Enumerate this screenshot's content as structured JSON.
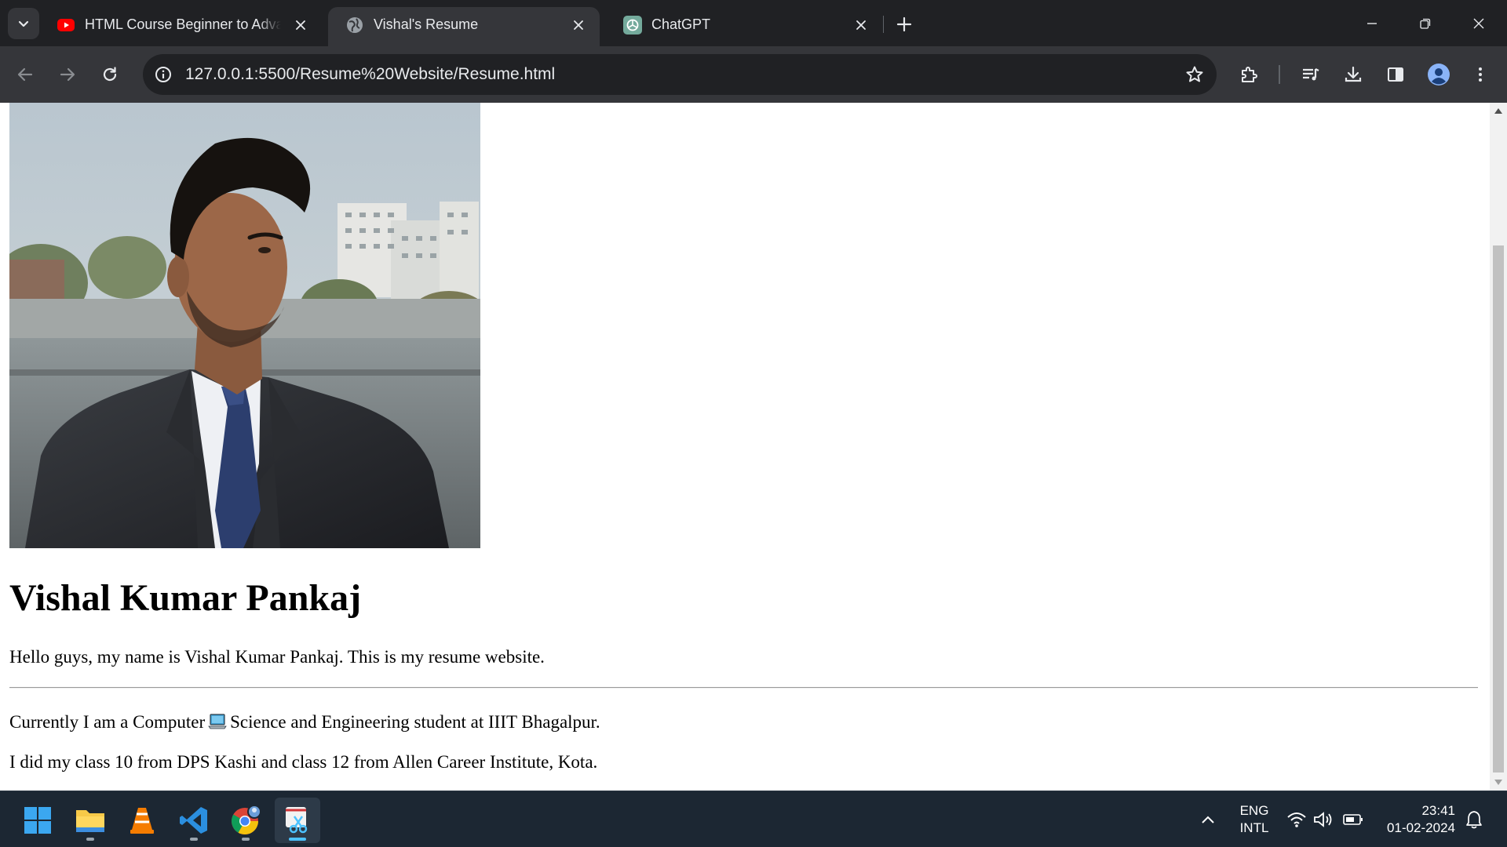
{
  "browser": {
    "tabs": [
      {
        "title": "HTML Course Beginner to Advanced",
        "favicon": "youtube-icon",
        "active": false
      },
      {
        "title": "Vishal's Resume",
        "favicon": "globe-icon",
        "active": true
      },
      {
        "title": "ChatGPT",
        "favicon": "chatgpt-icon",
        "active": false
      }
    ],
    "url": "127.0.0.1:5500/Resume%20Website/Resume.html",
    "colors": {
      "tabstrip": "#202124",
      "toolbar": "#35363a",
      "omnibox": "#202124",
      "text": "#e8eaed"
    }
  },
  "page": {
    "photo_alt": "Portrait photo of Vishal Kumar Pankaj in a dark suit and navy tie",
    "name": "Vishal Kumar Pankaj",
    "intro": "Hello guys, my name is Vishal Kumar Pankaj. This is my resume website.",
    "education_before": "Currently I am a Computer",
    "education_emoji": "laptop-icon",
    "education_after": "Science and Engineering student at IIIT Bhagalpur.",
    "schooling": "I did my class 10 from DPS Kashi and class 12 from Allen Career Institute, Kota."
  },
  "taskbar": {
    "apps": [
      "windows-start-icon",
      "file-explorer-icon",
      "vlc-icon",
      "vscode-icon",
      "chrome-icon",
      "snipping-tool-icon"
    ],
    "language_line1": "ENG",
    "language_line2": "INTL",
    "time": "23:41",
    "date": "01-02-2024",
    "colors": {
      "background": "#1c2733",
      "active_indicator": "#4cc2ff"
    }
  }
}
